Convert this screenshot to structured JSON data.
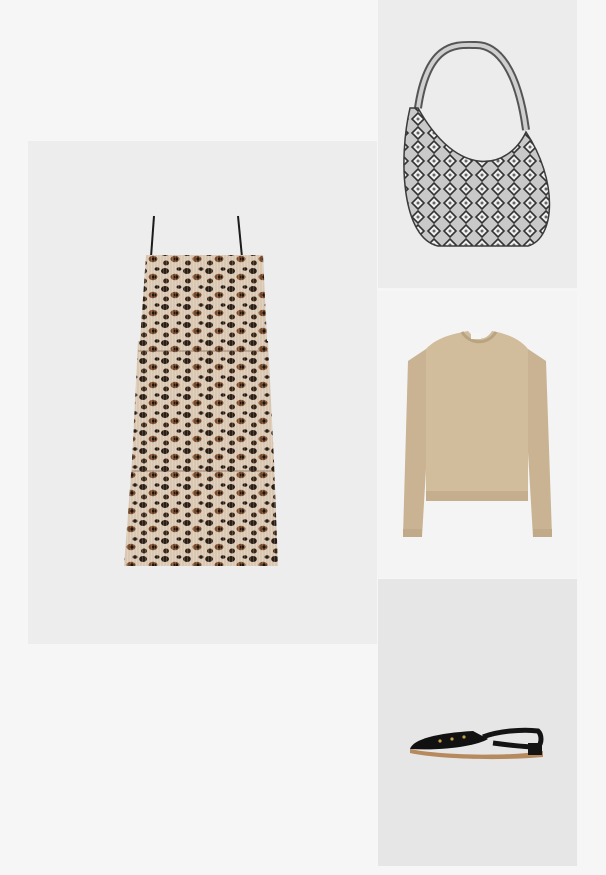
{
  "outfit": {
    "items": [
      {
        "key": "dress",
        "icon": "leopard-print-dress-image",
        "bg": "#ededed"
      },
      {
        "key": "bag",
        "icon": "snakeskin-shoulder-bag-image",
        "bg": "#ececec"
      },
      {
        "key": "sweater",
        "icon": "beige-knit-sweater-image",
        "bg": "#f4f4f4"
      },
      {
        "key": "shoe",
        "icon": "black-slingback-flat-image",
        "bg": "#e6e6e6"
      }
    ]
  }
}
